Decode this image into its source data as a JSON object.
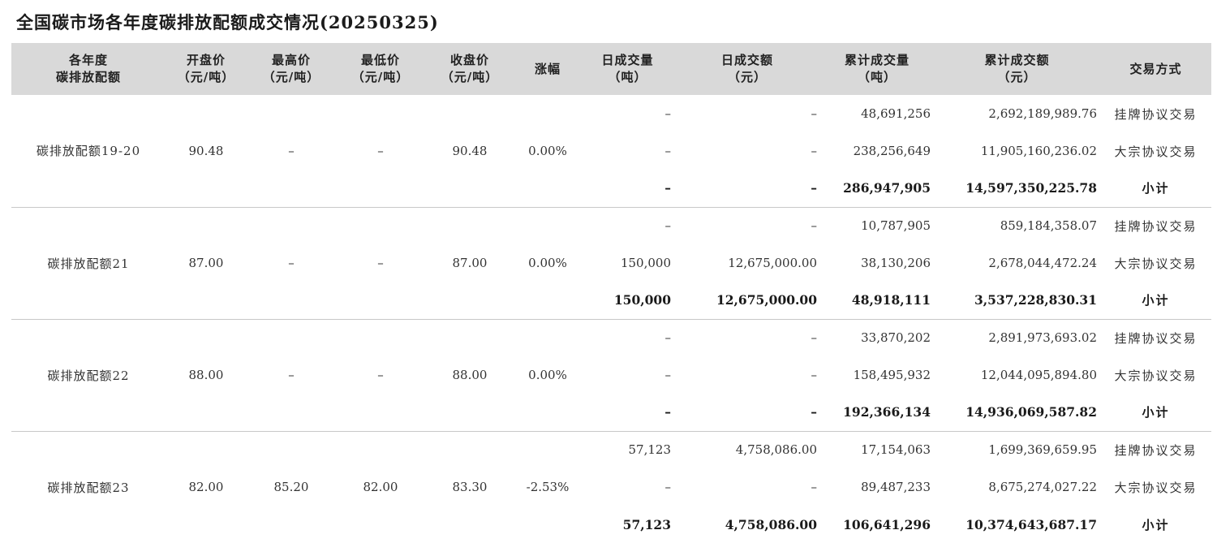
{
  "title": "全国碳市场各年度碳排放配额成交情况(20250325)",
  "columns": [
    {
      "line1": "各年度",
      "line2": "碳排放配额"
    },
    {
      "line1": "开盘价",
      "line2": "（元/吨）"
    },
    {
      "line1": "最高价",
      "line2": "（元/吨）"
    },
    {
      "line1": "最低价",
      "line2": "（元/吨）"
    },
    {
      "line1": "收盘价",
      "line2": "（元/吨）"
    },
    {
      "line1": "涨幅",
      "line2": ""
    },
    {
      "line1": "日成交量",
      "line2": "（吨）"
    },
    {
      "line1": "日成交额",
      "line2": "（元）"
    },
    {
      "line1": "累计成交量",
      "line2": "（吨）"
    },
    {
      "line1": "累计成交额",
      "line2": "（元）"
    },
    {
      "line1": "交易方式",
      "line2": ""
    }
  ],
  "groups": [
    {
      "name": "碳排放配额19-20",
      "open": "90.48",
      "high": "–",
      "low": "–",
      "close": "90.48",
      "change": "0.00%",
      "rows": [
        {
          "daily_volume": "–",
          "daily_amount": "–",
          "cum_volume": "48,691,256",
          "cum_amount": "2,692,189,989.76",
          "method": "挂牌协议交易"
        },
        {
          "daily_volume": "–",
          "daily_amount": "–",
          "cum_volume": "238,256,649",
          "cum_amount": "11,905,160,236.02",
          "method": "大宗协议交易"
        },
        {
          "daily_volume": "–",
          "daily_amount": "–",
          "cum_volume": "286,947,905",
          "cum_amount": "14,597,350,225.78",
          "method": "小计"
        }
      ]
    },
    {
      "name": "碳排放配额21",
      "open": "87.00",
      "high": "–",
      "low": "–",
      "close": "87.00",
      "change": "0.00%",
      "rows": [
        {
          "daily_volume": "–",
          "daily_amount": "–",
          "cum_volume": "10,787,905",
          "cum_amount": "859,184,358.07",
          "method": "挂牌协议交易"
        },
        {
          "daily_volume": "150,000",
          "daily_amount": "12,675,000.00",
          "cum_volume": "38,130,206",
          "cum_amount": "2,678,044,472.24",
          "method": "大宗协议交易"
        },
        {
          "daily_volume": "150,000",
          "daily_amount": "12,675,000.00",
          "cum_volume": "48,918,111",
          "cum_amount": "3,537,228,830.31",
          "method": "小计"
        }
      ]
    },
    {
      "name": "碳排放配额22",
      "open": "88.00",
      "high": "–",
      "low": "–",
      "close": "88.00",
      "change": "0.00%",
      "rows": [
        {
          "daily_volume": "–",
          "daily_amount": "–",
          "cum_volume": "33,870,202",
          "cum_amount": "2,891,973,693.02",
          "method": "挂牌协议交易"
        },
        {
          "daily_volume": "–",
          "daily_amount": "–",
          "cum_volume": "158,495,932",
          "cum_amount": "12,044,095,894.80",
          "method": "大宗协议交易"
        },
        {
          "daily_volume": "–",
          "daily_amount": "–",
          "cum_volume": "192,366,134",
          "cum_amount": "14,936,069,587.82",
          "method": "小计"
        }
      ]
    },
    {
      "name": "碳排放配额23",
      "open": "82.00",
      "high": "85.20",
      "low": "82.00",
      "close": "83.30",
      "change": "-2.53%",
      "rows": [
        {
          "daily_volume": "57,123",
          "daily_amount": "4,758,086.00",
          "cum_volume": "17,154,063",
          "cum_amount": "1,699,369,659.95",
          "method": "挂牌协议交易"
        },
        {
          "daily_volume": "–",
          "daily_amount": "–",
          "cum_volume": "89,487,233",
          "cum_amount": "8,675,274,027.22",
          "method": "大宗协议交易"
        },
        {
          "daily_volume": "57,123",
          "daily_amount": "4,758,086.00",
          "cum_volume": "106,641,296",
          "cum_amount": "10,374,643,687.17",
          "method": "小计"
        }
      ]
    }
  ]
}
